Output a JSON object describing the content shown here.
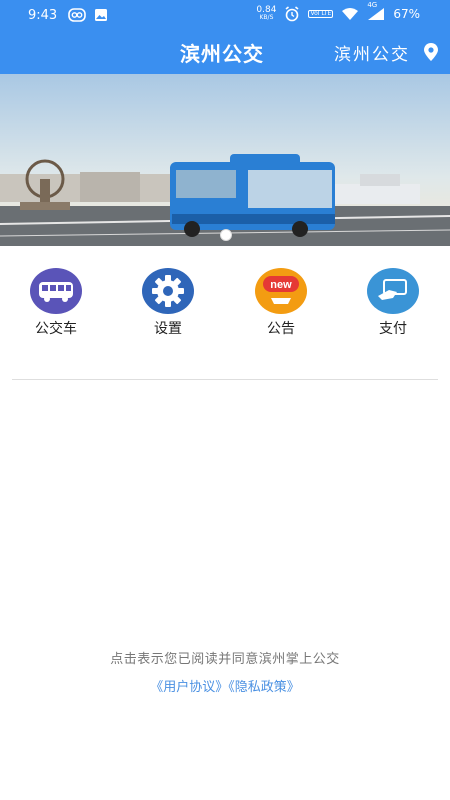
{
  "status_bar": {
    "time": "9:43",
    "speed_value": "0.84",
    "speed_unit": "KB/S",
    "volte_label": "Vol LTE",
    "network": "4G",
    "battery": "67%"
  },
  "header": {
    "title": "滨州公交",
    "city_label": "滨州公交"
  },
  "banner": {
    "active_slide": 1,
    "slide_count": 1
  },
  "menu": [
    {
      "label": "公交车",
      "icon": "bus-icon",
      "color": "#5a54b8"
    },
    {
      "label": "设置",
      "icon": "gear-icon",
      "color": "#2f66b9"
    },
    {
      "label": "公告",
      "icon": "new-announcement-icon",
      "badge": "new",
      "color": "#f39c12"
    },
    {
      "label": "支付",
      "icon": "payment-card-icon",
      "color": "#3a94d6"
    }
  ],
  "footer": {
    "notice": "点击表示您已阅读并同意滨州掌上公交",
    "user_agreement": "《用户协议》",
    "privacy_policy": "《隐私政策》"
  },
  "colors": {
    "header_bg": "#3a8ff0",
    "link": "#4a90e2"
  }
}
